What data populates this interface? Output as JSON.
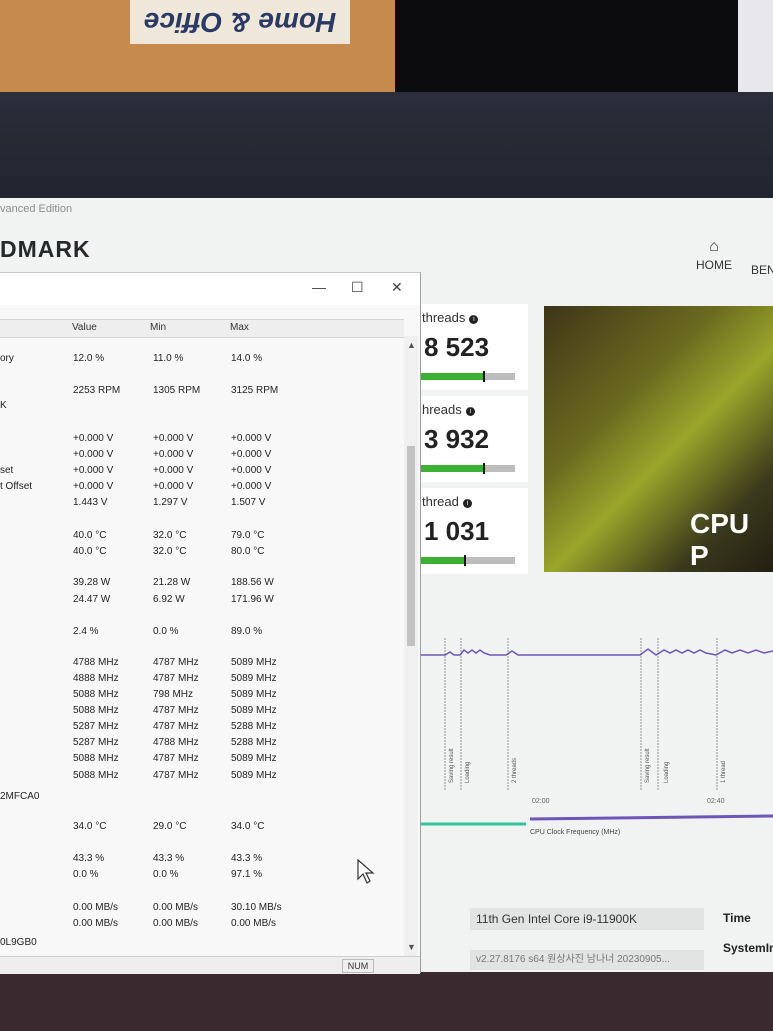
{
  "environment": {
    "box_label": "Home & Office"
  },
  "app": {
    "edition": "vanced Edition",
    "logo": "DMARK",
    "nav": {
      "home_label": "HOME",
      "next_label": "BEN"
    },
    "scores": [
      {
        "label": "threads",
        "value": "8 523",
        "fill": 0.67
      },
      {
        "label": "hreads",
        "value": "3 932",
        "fill": 0.67
      },
      {
        "label": "thread",
        "value": "1 031",
        "fill": 0.47
      }
    ],
    "banner_text": "CPU P",
    "timeline": {
      "markers": [
        "Saving result",
        "Loading",
        "2 threads",
        "Saving result",
        "Loading",
        "1 thread"
      ],
      "ticks": [
        "02:00",
        "02:40"
      ],
      "legend": "CPU Clock Frequency (MHz)"
    },
    "system_info": {
      "cpu": "11th Gen Intel Core i9-11900K",
      "version": "v2.27.8176 s64  원상사진 남나너 20230905...",
      "time_label": "Time",
      "systeminfo_label": "SystemIn"
    }
  },
  "sensor_window": {
    "buttons": {
      "minimize": "—",
      "maximize": "☐",
      "close": "✕"
    },
    "columns": [
      "Value",
      "Min",
      "Max"
    ],
    "rows": [
      [
        "ory",
        "12.0 %",
        "11.0 %",
        "14.0 %"
      ],
      [
        "",
        "2253 RPM",
        "1305 RPM",
        "3125 RPM"
      ],
      [
        "K",
        "",
        "",
        ""
      ],
      [
        "",
        "+0.000 V",
        "+0.000 V",
        "+0.000 V"
      ],
      [
        "",
        "+0.000 V",
        "+0.000 V",
        "+0.000 V"
      ],
      [
        "set",
        "+0.000 V",
        "+0.000 V",
        "+0.000 V"
      ],
      [
        "t Offset",
        "+0.000 V",
        "+0.000 V",
        "+0.000 V"
      ],
      [
        "",
        "1.443 V",
        "1.297 V",
        "1.507 V"
      ],
      [
        "",
        "40.0 °C",
        "32.0 °C",
        "79.0 °C"
      ],
      [
        "",
        "40.0 °C",
        "32.0 °C",
        "80.0 °C"
      ],
      [
        "",
        "39.28 W",
        "21.28 W",
        "188.56 W"
      ],
      [
        "",
        "24.47 W",
        "6.92 W",
        "171.96 W"
      ],
      [
        "",
        "2.4 %",
        "0.0 %",
        "89.0 %"
      ],
      [
        "",
        "4788 MHz",
        "4787 MHz",
        "5089 MHz"
      ],
      [
        "",
        "4888 MHz",
        "4787 MHz",
        "5089 MHz"
      ],
      [
        "",
        "5088 MHz",
        "798 MHz",
        "5089 MHz"
      ],
      [
        "",
        "5088 MHz",
        "4787 MHz",
        "5089 MHz"
      ],
      [
        "",
        "5287 MHz",
        "4787 MHz",
        "5288 MHz"
      ],
      [
        "",
        "5287 MHz",
        "4788 MHz",
        "5288 MHz"
      ],
      [
        "",
        "5088 MHz",
        "4787 MHz",
        "5089 MHz"
      ],
      [
        "",
        "5088 MHz",
        "4787 MHz",
        "5089 MHz"
      ],
      [
        "2MFCA0",
        "",
        "",
        ""
      ],
      [
        "",
        "34.0 °C",
        "29.0 °C",
        "34.0 °C"
      ],
      [
        "",
        "43.3 %",
        "43.3 %",
        "43.3 %"
      ],
      [
        "",
        "0.0 %",
        "0.0 %",
        "97.1 %"
      ],
      [
        "",
        "0.00 MB/s",
        "0.00 MB/s",
        "30.10 MB/s"
      ],
      [
        "",
        "0.00 MB/s",
        "0.00 MB/s",
        "0.00 MB/s"
      ],
      [
        "0L9GB0",
        "",
        "",
        ""
      ]
    ],
    "status": {
      "num": "NUM"
    }
  }
}
